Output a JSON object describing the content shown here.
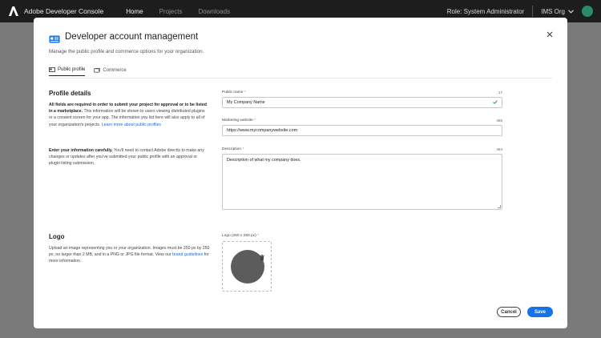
{
  "topbar": {
    "app_title": "Adobe Developer Console",
    "nav": [
      "Home",
      "Projects",
      "Downloads"
    ],
    "role": "Role: System Administrator",
    "org": "IMS Org"
  },
  "modal": {
    "title": "Developer account management",
    "subtitle": "Manage the public profile and commerce options for your organization.",
    "tabs": [
      {
        "label": "Public profile",
        "icon": "profile-card-icon",
        "active": true
      },
      {
        "label": "Commerce",
        "icon": "commerce-icon",
        "active": false
      }
    ],
    "profile": {
      "heading": "Profile details",
      "help_p1_bold": "All fields are required in order to submit your project for approval or to be listed in a marketplace.",
      "help_p1_rest": " This information will be shown to users viewing distributed plugins or a consent screen for your app. The information you list here will also apply to all of your organization's projects. ",
      "help_p1_link": "Learn more about public profiles",
      "help_p2_bold": "Enter your information carefully.",
      "help_p2_rest": " You'll need to contact Adobe directly to make any changes or updates after you've submitted your public profile with an approval or plugin listing submission."
    },
    "fields": {
      "public_name": {
        "label": "Public name",
        "required": "*",
        "count": "17",
        "value": "My Company Name"
      },
      "marketing_website": {
        "label": "Marketing website",
        "required": "*",
        "count": "468",
        "value": "https://www.mycompanywebsite.com"
      },
      "description": {
        "label": "Description",
        "required": "*",
        "count": "464",
        "value": "Description of what my company does."
      }
    },
    "logo": {
      "heading": "Logo",
      "help_text": "Upload an image representing you or your organization. Images must be 250 px by 250 px, no larger than 2 MB, and in a PNG or JPG file format. View our ",
      "help_link": "brand guidelines",
      "help_tail": " for more information.",
      "field_label": "Logo (250 x 250 px)",
      "required": "*"
    },
    "buttons": {
      "cancel": "Cancel",
      "save": "Save"
    }
  },
  "colors": {
    "accent": "#1473e6",
    "topbar": "#1d1d1d",
    "success": "#2d8a4e"
  }
}
